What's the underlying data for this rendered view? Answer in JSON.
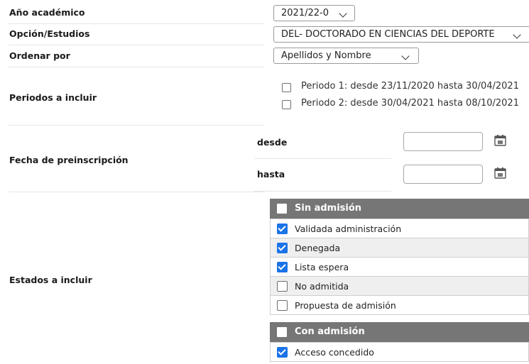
{
  "fields": {
    "year": {
      "label": "Año académico",
      "value": "2021/22-0"
    },
    "study": {
      "label": "Opción/Estudios",
      "value": "DEL- DOCTORADO EN CIENCIAS DEL DEPORTE"
    },
    "order": {
      "label": "Ordenar por",
      "value": "Apellidos y Nombre"
    },
    "periods": {
      "label": "Periodos a incluir",
      "items": [
        {
          "label": "Periodo 1: desde 23/11/2020 hasta 30/04/2021",
          "checked": false
        },
        {
          "label": "Periodo 2: desde 30/04/2021 hasta 08/10/2021",
          "checked": false
        }
      ]
    },
    "preinscription": {
      "label": "Fecha de preinscripción",
      "from_label": "desde",
      "to_label": "hasta",
      "from_value": "",
      "to_value": ""
    },
    "states": {
      "label": "Estados a incluir",
      "groups": [
        {
          "title": "Sin admisión",
          "items": [
            {
              "label": "Validada administración",
              "checked": true
            },
            {
              "label": "Denegada",
              "checked": true
            },
            {
              "label": "Lista espera",
              "checked": true
            },
            {
              "label": "No admitida",
              "checked": false
            },
            {
              "label": "Propuesta de admisión",
              "checked": false
            }
          ]
        },
        {
          "title": "Con admisión",
          "items": [
            {
              "label": "Acceso concedido",
              "checked": true
            }
          ]
        }
      ]
    }
  },
  "icons": {
    "calendar": "calendar-icon",
    "dropdown": "chevron-down-icon"
  },
  "colors": {
    "checkbox_checked": "#1a73e8",
    "group_header": "#767676",
    "row_alt": "#efefef"
  }
}
